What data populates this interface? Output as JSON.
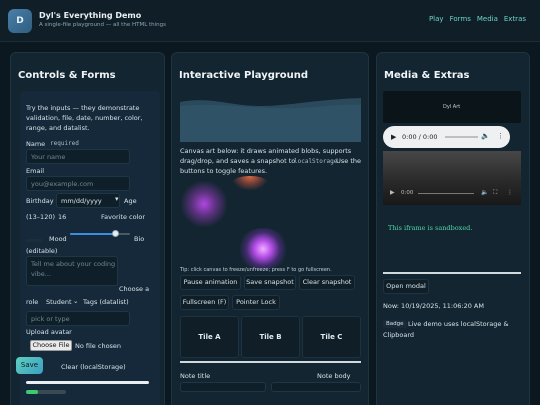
{
  "app": {
    "logo_letter": "D",
    "title": "Dyl's Everything Demo",
    "subtitle": "A single-file playground — all the HTML things"
  },
  "nav": [
    "Play",
    "Forms",
    "Media",
    "Extras"
  ],
  "controls": {
    "heading": "Controls & Forms",
    "intro": [
      "Try the inputs — they demonstrate",
      "validation, file, date, number, color,",
      "range, and datalist."
    ],
    "name_label": "Name",
    "name_required_chip": "required",
    "name_placeholder": "Your name",
    "email_label": "Email",
    "email_placeholder": "you@example.com",
    "birthday_label": "Birthday",
    "birthday_placeholder": "mm/dd/yyyy",
    "age_label": "Age",
    "age_range_label": "(13–120)",
    "age_value": "16",
    "favorite_color_label": "Favorite color",
    "mood_label": "Mood",
    "mood_value": 0.75,
    "bio_label": "Bio",
    "bio_editable": "(editable)",
    "bio_placeholder": [
      "Tell me about your coding",
      "vibe..."
    ],
    "role_label_a": "Choose a",
    "role_label_b": "role",
    "role_value": "Student",
    "tags_label": "Tags (datalist)",
    "tags_placeholder": "pick or type",
    "avatar_label": "Upload avatar",
    "file_button": "Choose File",
    "file_status": "No file chosen",
    "save_button": "Save",
    "clear_button": "Clear (localStorage)",
    "progress_value": 0.3
  },
  "playground": {
    "heading": "Interactive Playground",
    "desc": [
      "Canvas art below: it draws animated blobs, supports",
      "drag/drop, and saves a snapshot to",
      "localStorage",
      ". Use the",
      "buttons to toggle features."
    ],
    "tip_a": "Tip: click canvas to freeze/unfreeze; press",
    "tip_key": "F",
    "tip_b": "to go fullscreen.",
    "buttons": [
      "Pause animation",
      "Save snapshot",
      "Clear snapshot",
      "Fullscreen (F)",
      "Pointer Lock"
    ],
    "tiles": [
      "Tile A",
      "Tile B",
      "Tile C"
    ],
    "note_title_label": "Note title",
    "note_body_label": "Note body"
  },
  "media": {
    "heading": "Media & Extras",
    "art_label": "Dyl Art",
    "audio_time": "0:00 / 0:00",
    "video_time": "0:00",
    "iframe_text": "This iframe is sandboxed.",
    "modal_button": "Open modal",
    "now_text": "Now: 10/19/2025, 11:06:20 AM",
    "badge": "Badge",
    "badge_desc_a": "Live demo uses localStorage &",
    "badge_desc_b": "Clipboard"
  }
}
